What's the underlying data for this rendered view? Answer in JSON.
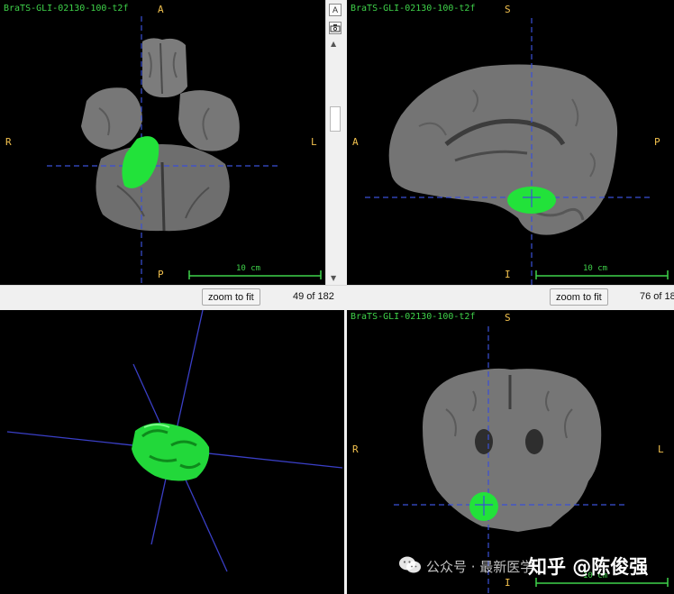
{
  "axial": {
    "series": "BraTS-GLI-02130-100-t2f",
    "top": "A",
    "left": "R",
    "right": "L",
    "bottom": "P",
    "scale": "10 cm",
    "zoom_label": "zoom to fit",
    "slice": "49 of 182"
  },
  "sagittal": {
    "series": "BraTS-GLI-02130-100-t2f",
    "top": "S",
    "left": "A",
    "right": "P",
    "bottom": "I",
    "scale": "10 cm",
    "zoom_label": "zoom to fit",
    "slice": "76 of 18"
  },
  "render3d": {},
  "coronal": {
    "series": "BraTS-GLI-02130-100-t2f",
    "top": "S",
    "left": "R",
    "right": "L",
    "bottom": "I",
    "scale": "10 cm"
  },
  "toolbar": {
    "a_label": "A"
  },
  "watermark": {
    "wechat": "公众号 · 最新医学",
    "zhihu": "知乎 @陈俊强"
  },
  "colors": {
    "segmentation": "#22e23a",
    "crosshair": "#3a4fd6",
    "annotation": "#f2c14e",
    "series": "#3fd24a"
  }
}
